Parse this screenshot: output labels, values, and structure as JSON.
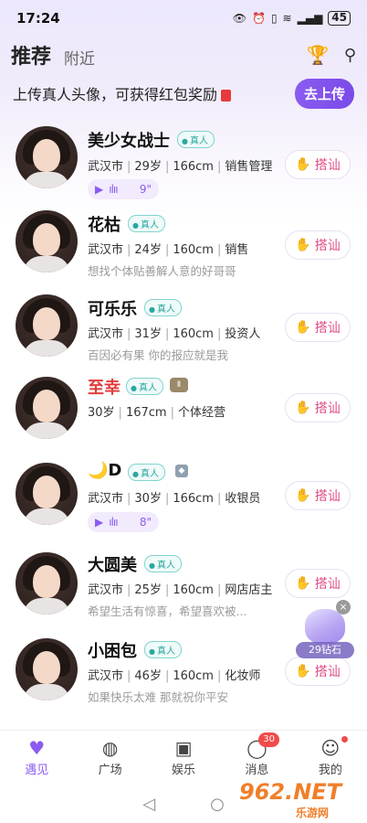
{
  "status_bar": {
    "time": "17:24",
    "battery": "45"
  },
  "header": {
    "tab_active": "推荐",
    "tab_inactive": "附近"
  },
  "banner": {
    "text": "上传真人头像，可获得红包奖励",
    "button": "去上传"
  },
  "verified_label": "真人",
  "chat_label": "搭讪",
  "users": [
    {
      "name": "美少女战士",
      "info": [
        "武汉市",
        "29岁",
        "166cm",
        "销售管理"
      ],
      "voice": "9\"",
      "bio": ""
    },
    {
      "name": "花枯",
      "info": [
        "武汉市",
        "24岁",
        "160cm",
        "销售"
      ],
      "bio": "想找个体贴善解人意的好哥哥"
    },
    {
      "name": "可乐乐",
      "info": [
        "武汉市",
        "31岁",
        "160cm",
        "投资人"
      ],
      "bio": "百因必有果 你的报应就是我"
    },
    {
      "name": "至幸",
      "info": [
        "30岁",
        "167cm",
        "个体经营"
      ],
      "bio": ""
    },
    {
      "name": "🌙D",
      "info": [
        "武汉市",
        "30岁",
        "166cm",
        "收银员"
      ],
      "voice": "8\"",
      "bio": ""
    },
    {
      "name": "大圆美",
      "info": [
        "武汉市",
        "25岁",
        "160cm",
        "网店店主"
      ],
      "bio": "希望生活有惊喜，希望喜欢被..."
    },
    {
      "name": "小困包",
      "info": [
        "武汉市",
        "46岁",
        "160cm",
        "化妆师"
      ],
      "bio": "如果快乐太难 那就祝你平安"
    }
  ],
  "float_ad": {
    "price": "29钻石"
  },
  "nav": [
    {
      "label": "遇见",
      "icon": "heart-pulse-icon"
    },
    {
      "label": "广场",
      "icon": "planet-icon"
    },
    {
      "label": "娱乐",
      "icon": "play-box-icon"
    },
    {
      "label": "消息",
      "icon": "chat-bubble-icon",
      "badge": "30"
    },
    {
      "label": "我的",
      "icon": "profile-icon"
    }
  ],
  "watermark": {
    "main": "962.NET",
    "sub": "乐游网"
  }
}
